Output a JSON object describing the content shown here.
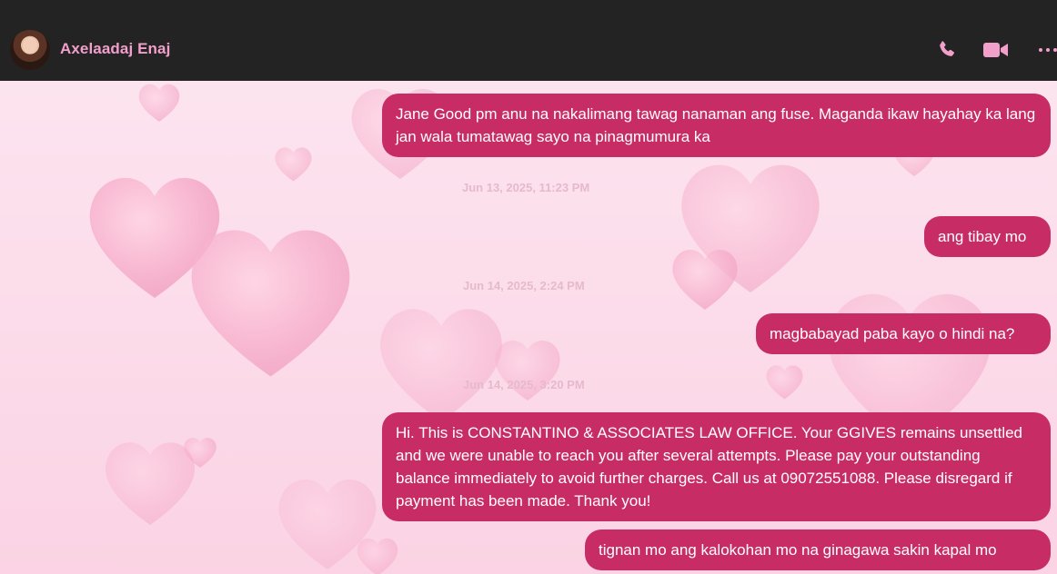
{
  "header": {
    "contact_name": "Axelaadaj Enaj",
    "icons": [
      "phone-icon",
      "video-icon",
      "more-icon"
    ],
    "accent_color": "#f29fcb"
  },
  "messages": [
    {
      "text": "Jane Good pm anu na nakalimang tawag nanaman ang fuse. Maganda ikaw hayahay ka lang jan wala tumatawag sayo na pinagmumura ka"
    },
    {
      "text": "ang tibay mo"
    },
    {
      "text": "magbabayad paba kayo o hindi na?"
    },
    {
      "text": "Hi. This is CONSTANTINO & ASSOCIATES LAW OFFICE. Your GGIVES remains unsettled and we were unable to reach you after several attempts. Please pay your outstanding balance immediately to avoid further charges. Call us at 09072551088. Please disregard if payment has been made. Thank you!"
    },
    {
      "text": "tignan mo ang kalokohan mo na ginagawa sakin kapal mo"
    }
  ],
  "timestamps": [
    "Jun 13, 2025, 11:23 PM",
    "Jun 14, 2025, 2:24 PM",
    "Jun 14, 2025, 3:20 PM"
  ],
  "colors": {
    "header_bg": "#232323",
    "bubble": "#c82c64",
    "chat_bg": "#fce4ef"
  }
}
